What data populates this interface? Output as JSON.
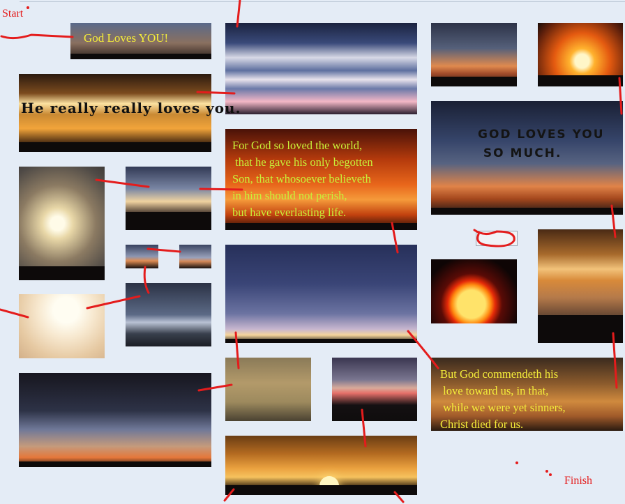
{
  "labels": {
    "start": "Start",
    "finish": "Finish"
  },
  "overlays": {
    "god_loves_you": "God Loves YOU!",
    "really_loves": "He really really loves you.",
    "john_3_16": "For God so loved the world,\n that he gave his only begotten\nSon, that whosoever believeth\nin him should not perish,\nbut have everlasting life.",
    "god_loves_much": "GOD LOVES YOU\n SO MUCH.",
    "romans_5_8": "But God commendeth his\n love toward us, in that,\n while we were yet sinners,\nChrist died for us."
  },
  "colors": {
    "background": "#e4ecf6",
    "path_stroke": "#e41c1c",
    "yellow_text": "#f5ee3a",
    "green_text": "#c8f23a"
  }
}
